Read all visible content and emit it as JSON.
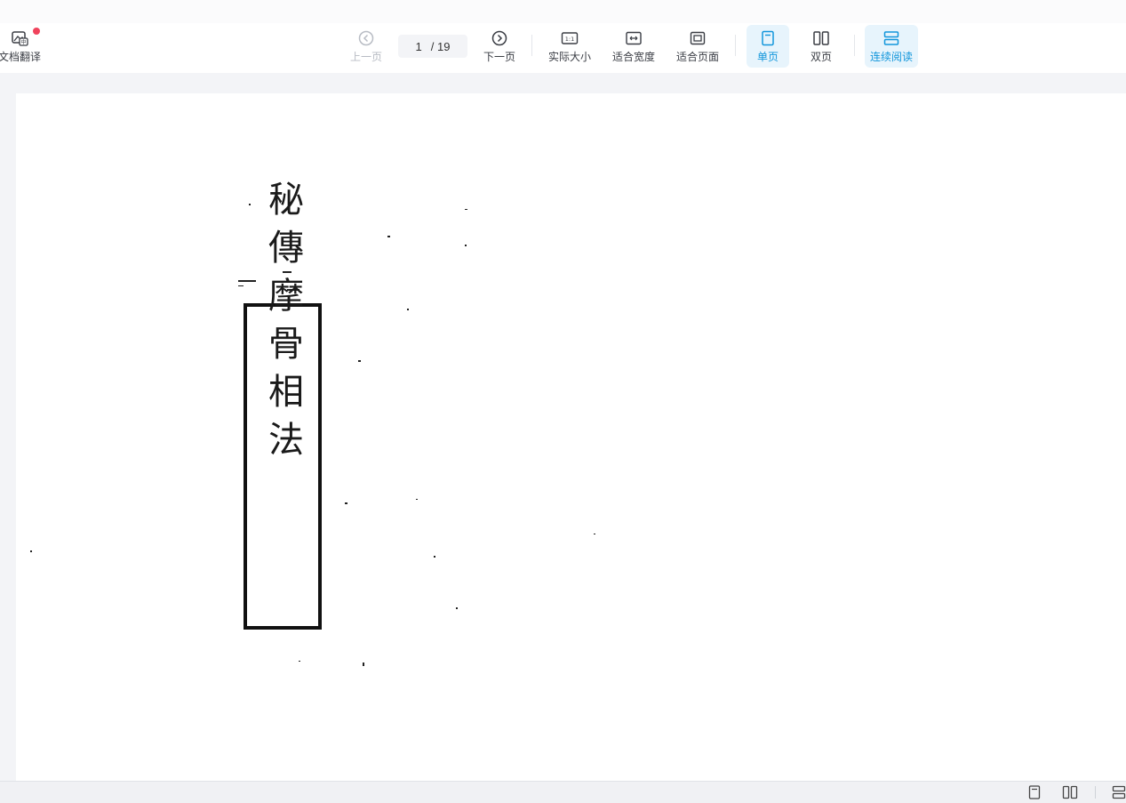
{
  "toolbar": {
    "translate_label": "文档翻译",
    "prev_label": "上一页",
    "current_page": "1",
    "total_pages": "/ 19",
    "next_label": "下一页",
    "actual_size_label": "实际大小",
    "fit_width_label": "适合宽度",
    "fit_page_label": "适合页面",
    "single_page_label": "单页",
    "double_page_label": "双页",
    "continuous_label": "连续阅读",
    "actual_size_glyph": "1:1"
  },
  "document": {
    "seal_text": "秘傳摩骨相法"
  },
  "colors": {
    "accent": "#1296db",
    "active_bg": "#e7f4fc",
    "notification_dot": "#f0435c",
    "viewer_bg": "#f3f4f7"
  },
  "icons": {
    "translate": "image-translate-icon",
    "prev": "chevron-left-circle-icon",
    "next": "chevron-right-circle-icon",
    "actual_size": "one-to-one-icon",
    "fit_width": "fit-width-icon",
    "fit_page": "fit-page-icon",
    "single": "single-page-icon",
    "double": "double-page-icon",
    "continuous": "continuous-scroll-icon"
  }
}
